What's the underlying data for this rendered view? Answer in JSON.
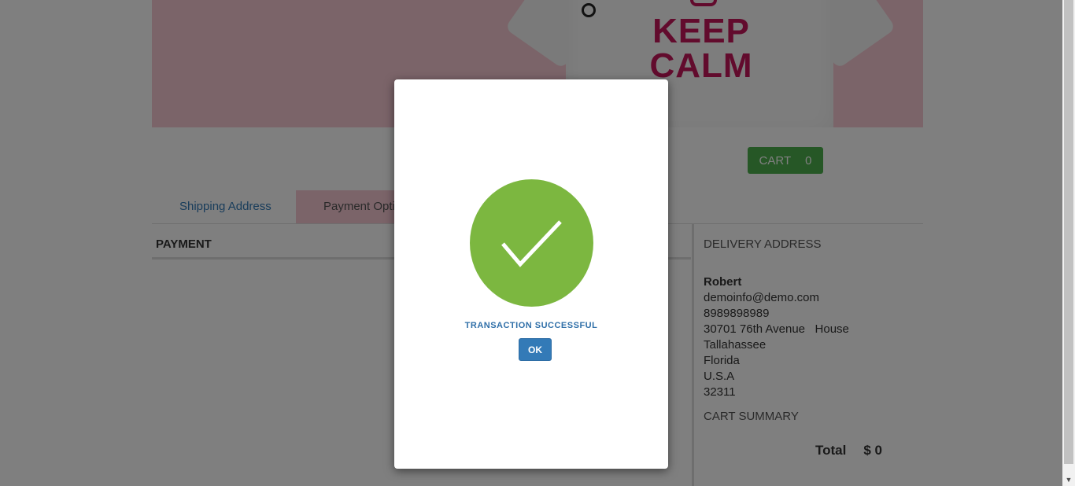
{
  "banner": {
    "shirt_text": "KEEP CALM"
  },
  "cart": {
    "label": "CART",
    "count": "0"
  },
  "tabs": [
    {
      "label": "Shipping Address"
    },
    {
      "label": "Payment Optio"
    }
  ],
  "payment": {
    "heading": "PAYMENT"
  },
  "delivery": {
    "heading": "DELIVERY ADDRESS",
    "name": "Robert",
    "email": "demoinfo@demo.com",
    "phone": "8989898989",
    "street": "30701 76th Avenue   House",
    "city": "Tallahassee",
    "state": "Florida",
    "country": "U.S.A",
    "zip": "32311"
  },
  "cart_summary": {
    "heading": "CART SUMMARY",
    "total_label": "Total",
    "total_value": "$ 0"
  },
  "modal": {
    "message": "TRANSACTION SUCCESSFUL",
    "ok_label": "OK"
  },
  "colors": {
    "success_green": "#7cb740",
    "primary_blue": "#337ab7",
    "cart_green": "#4cae4c",
    "banner_pink": "#f7c9d3",
    "brand_magenta": "#c4165a"
  }
}
